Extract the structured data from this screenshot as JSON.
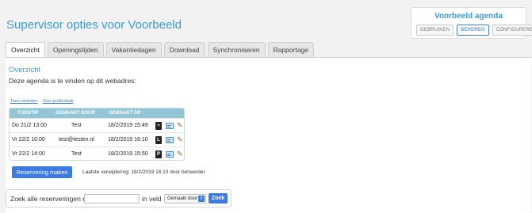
{
  "page": {
    "title": "Supervisor opties voor Voorbeeld"
  },
  "agenda_box": {
    "title": "Voorbeeld agenda",
    "buttons": [
      "GEBRUIKEN",
      "BEHEREN",
      "CONFIGUREREN"
    ],
    "active_button": "BEHEREN"
  },
  "tabs": [
    {
      "label": "Overzicht",
      "active": true
    },
    {
      "label": "Openingstijden",
      "active": false
    },
    {
      "label": "Vakantiedagen",
      "active": false
    },
    {
      "label": "Download",
      "active": false
    },
    {
      "label": "Synchroniseren",
      "active": false
    },
    {
      "label": "Rapportage",
      "active": false
    }
  ],
  "overview": {
    "title": "Overzicht",
    "description": "Deze agenda is te vinden op dit webadres:",
    "links": [
      "Toon verleden",
      "Toon prullenbak"
    ]
  },
  "table": {
    "columns": [
      "TIJDSTIP",
      "GEMAAKT DOOR",
      "GEMAAKT OP"
    ],
    "rows": [
      {
        "tijdstip": "Do 21/2 13:00",
        "gemaakt_door": "Test",
        "gemaakt_op": "18/2/2019 15:49",
        "tag": "+"
      },
      {
        "tijdstip": "Vr 22/2 10:00",
        "gemaakt_door": "test@testen.nl",
        "gemaakt_op": "18/2/2019 16:10",
        "tag": "L"
      },
      {
        "tijdstip": "Vr 22/2 14:00",
        "gemaakt_door": "Test",
        "gemaakt_op": "18/2/2019 15:50",
        "tag": "P"
      }
    ]
  },
  "actions": {
    "reserve_button": "Reservering maken",
    "last_removed": "Laatste verwijdering: 18/2/2019 16:10 door beheerder"
  },
  "search": {
    "label": "Zoek alle reserveringen met",
    "input_value": "",
    "in_field_label": "in veld",
    "field_selected": "Gemaakt door",
    "button": "Zoek"
  },
  "colors": {
    "accent": "#3a9ad9",
    "button_blue": "#3b7be3",
    "table_header": "#92c6d7"
  }
}
